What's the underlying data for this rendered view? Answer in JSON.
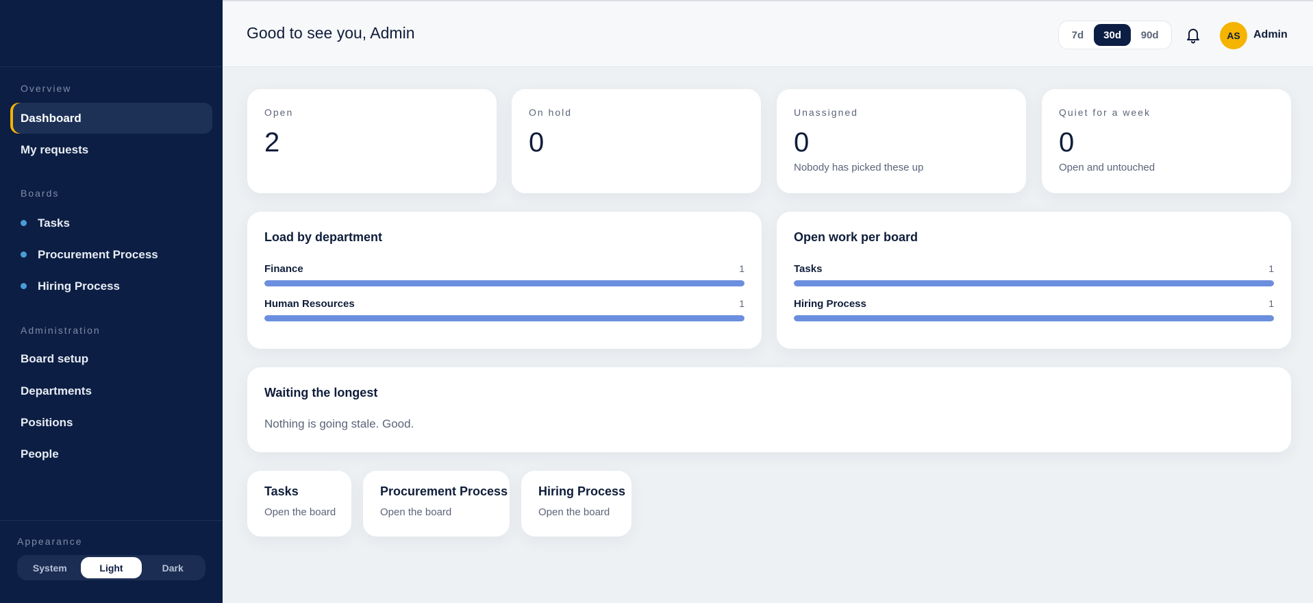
{
  "sidebar": {
    "sections": {
      "overview": "Overview",
      "boards": "Boards",
      "administration": "Administration",
      "appearance": "Appearance"
    },
    "overview_items": [
      {
        "label": "Dashboard",
        "active": true
      },
      {
        "label": "My requests",
        "active": false
      }
    ],
    "board_items": [
      {
        "label": "Tasks"
      },
      {
        "label": "Procurement Process"
      },
      {
        "label": "Hiring Process"
      }
    ],
    "admin_items": [
      {
        "label": "Board setup"
      },
      {
        "label": "Departments"
      },
      {
        "label": "Positions"
      },
      {
        "label": "People"
      }
    ],
    "appearance_options": [
      "System",
      "Light",
      "Dark"
    ],
    "appearance_selected": "Light"
  },
  "header": {
    "greeting": "Good to see you, Admin",
    "ranges": [
      "7d",
      "30d",
      "90d"
    ],
    "range_selected": "30d",
    "bell_icon": "bell-icon",
    "avatar_initials": "AS",
    "user_name": "Admin"
  },
  "stats": [
    {
      "label": "Open",
      "value": "2",
      "sub": ""
    },
    {
      "label": "On hold",
      "value": "0",
      "sub": ""
    },
    {
      "label": "Unassigned",
      "value": "0",
      "sub": "Nobody has picked these up"
    },
    {
      "label": "Quiet for a week",
      "value": "0",
      "sub": "Open and untouched"
    }
  ],
  "load_by_department": {
    "title": "Load by department",
    "rows": [
      {
        "label": "Finance",
        "value": "1",
        "fraction": 1.0
      },
      {
        "label": "Human Resources",
        "value": "1",
        "fraction": 1.0
      }
    ]
  },
  "open_work_per_board": {
    "title": "Open work per board",
    "rows": [
      {
        "label": "Tasks",
        "value": "1",
        "fraction": 1.0
      },
      {
        "label": "Hiring Process",
        "value": "1",
        "fraction": 1.0
      }
    ]
  },
  "waiting": {
    "title": "Waiting the longest",
    "empty_text": "Nothing is going stale. Good."
  },
  "boards": [
    {
      "title": "Tasks",
      "sub": "Open the board"
    },
    {
      "title": "Procurement Process",
      "sub": "Open the board"
    },
    {
      "title": "Hiring Process",
      "sub": "Open the board"
    }
  ],
  "colors": {
    "sidebar_bg": "#0c1e43",
    "accent": "#f5b400",
    "bar_fill": "#6b8fde",
    "board_dot": "#4a9cd6"
  }
}
